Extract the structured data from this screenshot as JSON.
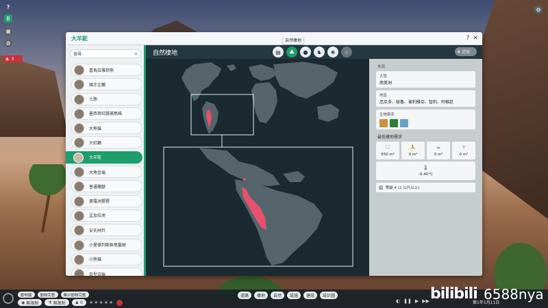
{
  "hud": {
    "help": "?",
    "alert_count": "3"
  },
  "panel": {
    "title": "大羊駝",
    "tooltip": "自然棲地",
    "controls": [
      "?",
      "✕"
    ]
  },
  "search": {
    "placeholder": "搜尋"
  },
  "species": [
    {
      "name": "喜馬拉雅棕熊",
      "selected": false
    },
    {
      "name": "國王企鵝",
      "selected": false
    },
    {
      "name": "土豚",
      "selected": false
    },
    {
      "name": "墨西哥紅膝捕鳥蛛",
      "selected": false
    },
    {
      "name": "大熊貓",
      "selected": false
    },
    {
      "name": "大紅鸛",
      "selected": false
    },
    {
      "name": "大羊駝",
      "selected": true
    },
    {
      "name": "大角金龜",
      "selected": false
    },
    {
      "name": "普通獵獸",
      "selected": false
    },
    {
      "name": "婆羅洲猩猩",
      "selected": false
    },
    {
      "name": "孟加拉虎",
      "selected": false
    },
    {
      "name": "安氏林羚",
      "selected": false
    },
    {
      "name": "小愛德列斯群島鬣蜥",
      "selected": false
    },
    {
      "name": "小熊貓",
      "selected": false
    },
    {
      "name": "巨型沼龜",
      "selected": false
    }
  ],
  "content": {
    "title": "自然棲地",
    "tabs": [
      {
        "icon": "document-icon",
        "glyph": "▤",
        "state": "normal"
      },
      {
        "icon": "habitat-icon",
        "glyph": "⛰",
        "state": "active"
      },
      {
        "icon": "food-icon",
        "glyph": "●",
        "state": "normal"
      },
      {
        "icon": "social-icon",
        "glyph": "♞",
        "state": "normal"
      },
      {
        "icon": "paw-icon",
        "glyph": "❀",
        "state": "normal"
      },
      {
        "icon": "trophy-icon",
        "glyph": "♛",
        "state": "disabled"
      }
    ],
    "user_chip": "遊客"
  },
  "info": {
    "section_label": "來源",
    "continent_label": "大陸",
    "continent_value": "南美洲",
    "region_label": "地區",
    "region_value": "厄瓜多、秘魯、玻利維亞、智利、阿根廷",
    "biome_label": "生物群系",
    "biome_colors": [
      "#c9923a",
      "#2e7d3a",
      "#6aa0c8"
    ],
    "requirements_title": "最低棲地需求",
    "requirements": [
      {
        "icon": "land-icon",
        "glyph": "⛶",
        "value": "550 m²"
      },
      {
        "icon": "climb-icon",
        "glyph": "⛹",
        "value": "0 m²"
      },
      {
        "icon": "water-icon",
        "glyph": "≈",
        "value": "0 m²"
      },
      {
        "icon": "deep-water-icon",
        "glyph": "⊤",
        "value": "0 m²"
      }
    ],
    "temperature": "-5-40°C",
    "grade": "等級 4 (2 公尺以上)"
  },
  "bottom": {
    "tabs": [
      "動物園",
      "動物完整",
      "藥示動物完整"
    ],
    "row": {
      "mode1": "無限制",
      "mode2": "無限制",
      "count": "0"
    },
    "tools": [
      "道路",
      "棲地",
      "自然",
      "設施",
      "建設",
      "設計圖"
    ],
    "date": "第1年1月11日",
    "watermark": "bilibili",
    "watermark_num": "6588nya"
  },
  "colors": {
    "accent": "#1f9d6c",
    "range": "#e8506e",
    "land": "#56656c"
  }
}
